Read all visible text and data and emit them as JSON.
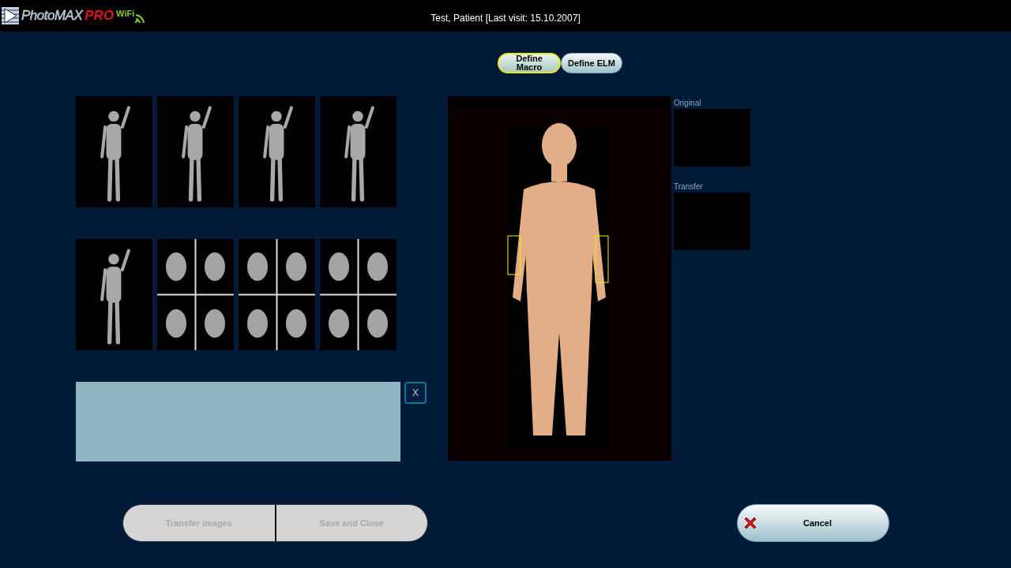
{
  "header": {
    "logo": {
      "name": "PhotoMAX",
      "edition": "PRO",
      "badge": "WiFi"
    },
    "title": "Test, Patient [Last visit: 15.10.2007]"
  },
  "view_tabs": [
    {
      "label": "Define Macro",
      "selected": true
    },
    {
      "label": "Define ELM",
      "selected": false
    }
  ],
  "thumbnails": [
    {
      "kind": "single"
    },
    {
      "kind": "single"
    },
    {
      "kind": "single"
    },
    {
      "kind": "single"
    },
    {
      "kind": "single"
    },
    {
      "kind": "quad"
    },
    {
      "kind": "quad"
    },
    {
      "kind": "quad"
    }
  ],
  "notes_close": "X",
  "preview_slots": [
    {
      "label": "Original"
    },
    {
      "label": "Transfer"
    }
  ],
  "actions": [
    {
      "label": "Transfer images",
      "disabled": true
    },
    {
      "label": "Save and Close",
      "disabled": true
    }
  ],
  "cancel": {
    "label": "Cancel",
    "disabled": false
  }
}
